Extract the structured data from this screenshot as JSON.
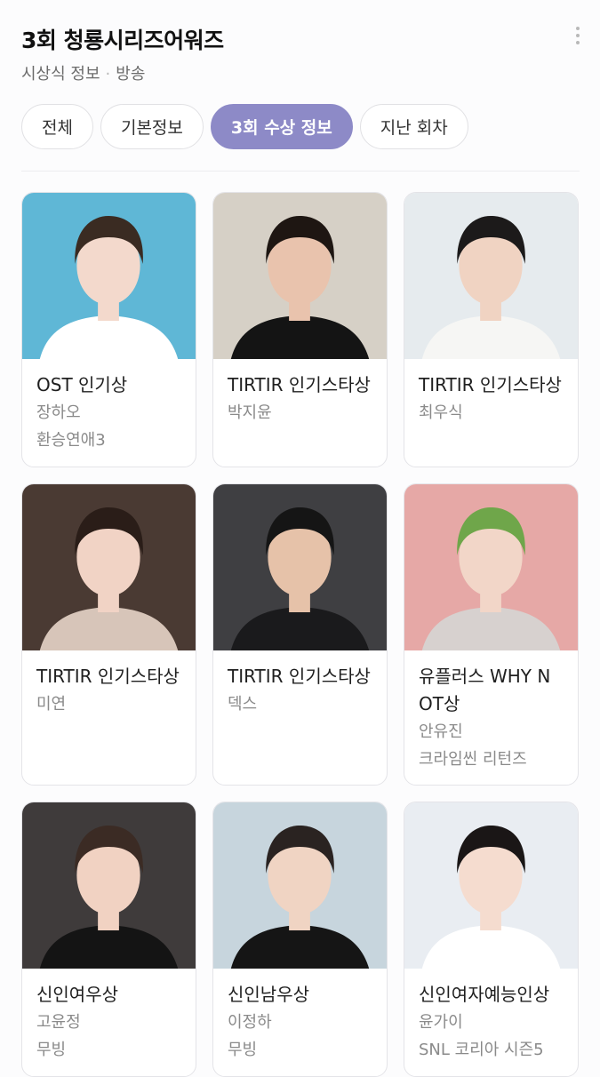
{
  "header": {
    "title": "3회 청룡시리즈어워즈",
    "subtitle_1": "시상식 정보",
    "subtitle_sep": "·",
    "subtitle_2": "방송"
  },
  "tabs": [
    {
      "label": "전체",
      "active": false
    },
    {
      "label": "기본정보",
      "active": false
    },
    {
      "label": "3회 수상 정보",
      "active": true
    },
    {
      "label": "지난 회차",
      "active": false
    }
  ],
  "awards": [
    {
      "award": "OST 인기상",
      "name": "장하오",
      "work": "환승연애3",
      "photo": {
        "bg": "#5fb7d6",
        "skin": "#f3d9cc",
        "hair": "#3a2b22",
        "cloth": "#ffffff"
      }
    },
    {
      "award": "TIRTIR 인기스타상",
      "name": "박지윤",
      "work": "",
      "photo": {
        "bg": "#d6d0c6",
        "skin": "#e9c3ad",
        "hair": "#1e1612",
        "cloth": "#141414"
      }
    },
    {
      "award": "TIRTIR 인기스타상",
      "name": "최우식",
      "work": "",
      "photo": {
        "bg": "#e6ebee",
        "skin": "#f0d3c2",
        "hair": "#1c1a1a",
        "cloth": "#f6f6f4"
      }
    },
    {
      "award": "TIRTIR 인기스타상",
      "name": "미연",
      "work": "",
      "photo": {
        "bg": "#4a3a33",
        "skin": "#f1d3c5",
        "hair": "#2a1d18",
        "cloth": "#d7c5b9"
      }
    },
    {
      "award": "TIRTIR 인기스타상",
      "name": "덱스",
      "work": "",
      "photo": {
        "bg": "#3f3f42",
        "skin": "#e6c2a9",
        "hair": "#151515",
        "cloth": "#1a1a1c"
      }
    },
    {
      "award": "유플러스 WHY NOT상",
      "name": "안유진",
      "work": "크라임씬 리턴즈",
      "photo": {
        "bg": "#e6a8a6",
        "skin": "#f2d6c8",
        "hair": "#6fa64a",
        "cloth": "#d7d1cf"
      }
    },
    {
      "award": "신인여우상",
      "name": "고윤정",
      "work": "무빙",
      "photo": {
        "bg": "#3f3b3b",
        "skin": "#f1d2c2",
        "hair": "#3b2b24",
        "cloth": "#141414"
      }
    },
    {
      "award": "신인남우상",
      "name": "이정하",
      "work": "무빙",
      "photo": {
        "bg": "#c7d5dd",
        "skin": "#f0d4c3",
        "hair": "#2a2321",
        "cloth": "#151515"
      }
    },
    {
      "award": "신인여자예능인상",
      "name": "윤가이",
      "work": "SNL 코리아 시즌5",
      "photo": {
        "bg": "#e9edf2",
        "skin": "#f5dccf",
        "hair": "#1a1616",
        "cloth": "#ffffff"
      }
    }
  ]
}
